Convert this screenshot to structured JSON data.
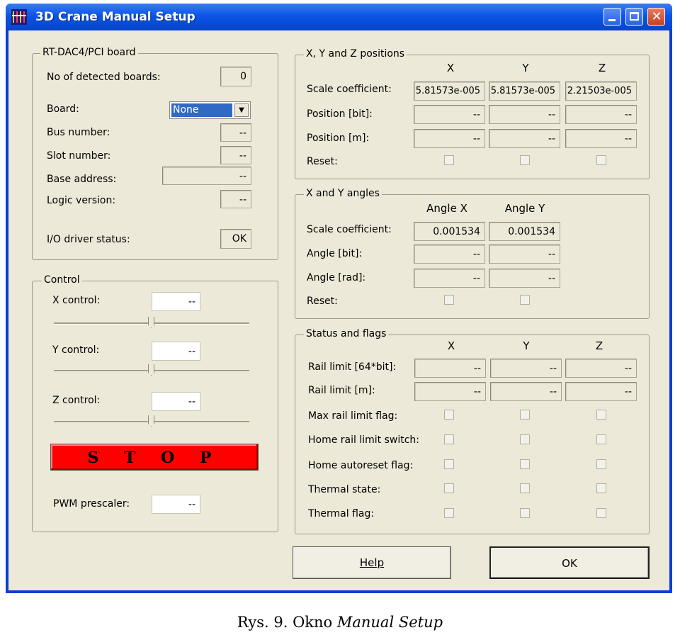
{
  "window": {
    "title": "3D Crane Manual Setup"
  },
  "board": {
    "group_title": "RT-DAC4/PCI board",
    "detected_label": "No of detected boards:",
    "detected_value": "0",
    "board_label": "Board:",
    "board_value": "None",
    "bus_label": "Bus number:",
    "bus_value": "--",
    "slot_label": "Slot number:",
    "slot_value": "--",
    "base_label": "Base address:",
    "base_value": "--",
    "logic_label": "Logic version:",
    "logic_value": "--",
    "io_label": "I/O driver status:",
    "io_value": "OK"
  },
  "control": {
    "group_title": "Control",
    "x_label": "X control:",
    "x_value": "--",
    "y_label": "Y control:",
    "y_value": "--",
    "z_label": "Z control:",
    "z_value": "--",
    "stop_label": "S T O P",
    "pwm_label": "PWM prescaler:",
    "pwm_value": "--"
  },
  "positions": {
    "group_title": "X, Y and Z positions",
    "col_x": "X",
    "col_y": "Y",
    "col_z": "Z",
    "scale_label": "Scale coefficient:",
    "scale_x": "5.81573e-005",
    "scale_y": "5.81573e-005",
    "scale_z": "2.21503e-005",
    "pos_bit_label": "Position [bit]:",
    "pos_bit_x": "--",
    "pos_bit_y": "--",
    "pos_bit_z": "--",
    "pos_m_label": "Position [m]:",
    "pos_m_x": "--",
    "pos_m_y": "--",
    "pos_m_z": "--",
    "reset_label": "Reset:"
  },
  "angles": {
    "group_title": "X and Y angles",
    "col_x": "Angle X",
    "col_y": "Angle Y",
    "scale_label": "Scale coefficient:",
    "scale_x": "0.001534",
    "scale_y": "0.001534",
    "bit_label": "Angle [bit]:",
    "bit_x": "--",
    "bit_y": "--",
    "rad_label": "Angle [rad]:",
    "rad_x": "--",
    "rad_y": "--",
    "reset_label": "Reset:"
  },
  "status": {
    "group_title": "Status and flags",
    "col_x": "X",
    "col_y": "Y",
    "col_z": "Z",
    "rail_bit_label": "Rail limit [64*bit]:",
    "rail_bit_x": "--",
    "rail_bit_y": "--",
    "rail_bit_z": "--",
    "rail_m_label": "Rail limit [m]:",
    "rail_m_x": "--",
    "rail_m_y": "--",
    "rail_m_z": "--",
    "max_flag_label": "Max rail limit flag:",
    "home_switch_label": "Home rail limit switch:",
    "home_reset_label": "Home autoreset flag:",
    "thermal_state_label": "Thermal state:",
    "thermal_flag_label": "Thermal flag:"
  },
  "buttons": {
    "help": "Help",
    "ok": "OK"
  },
  "caption": {
    "prefix": "Rys. 9. Okno ",
    "italic": "Manual Setup"
  },
  "colors": {
    "titlebar": "#0a55e6",
    "stop": "#ff0000",
    "dialog_bg": "#ece9d8"
  }
}
